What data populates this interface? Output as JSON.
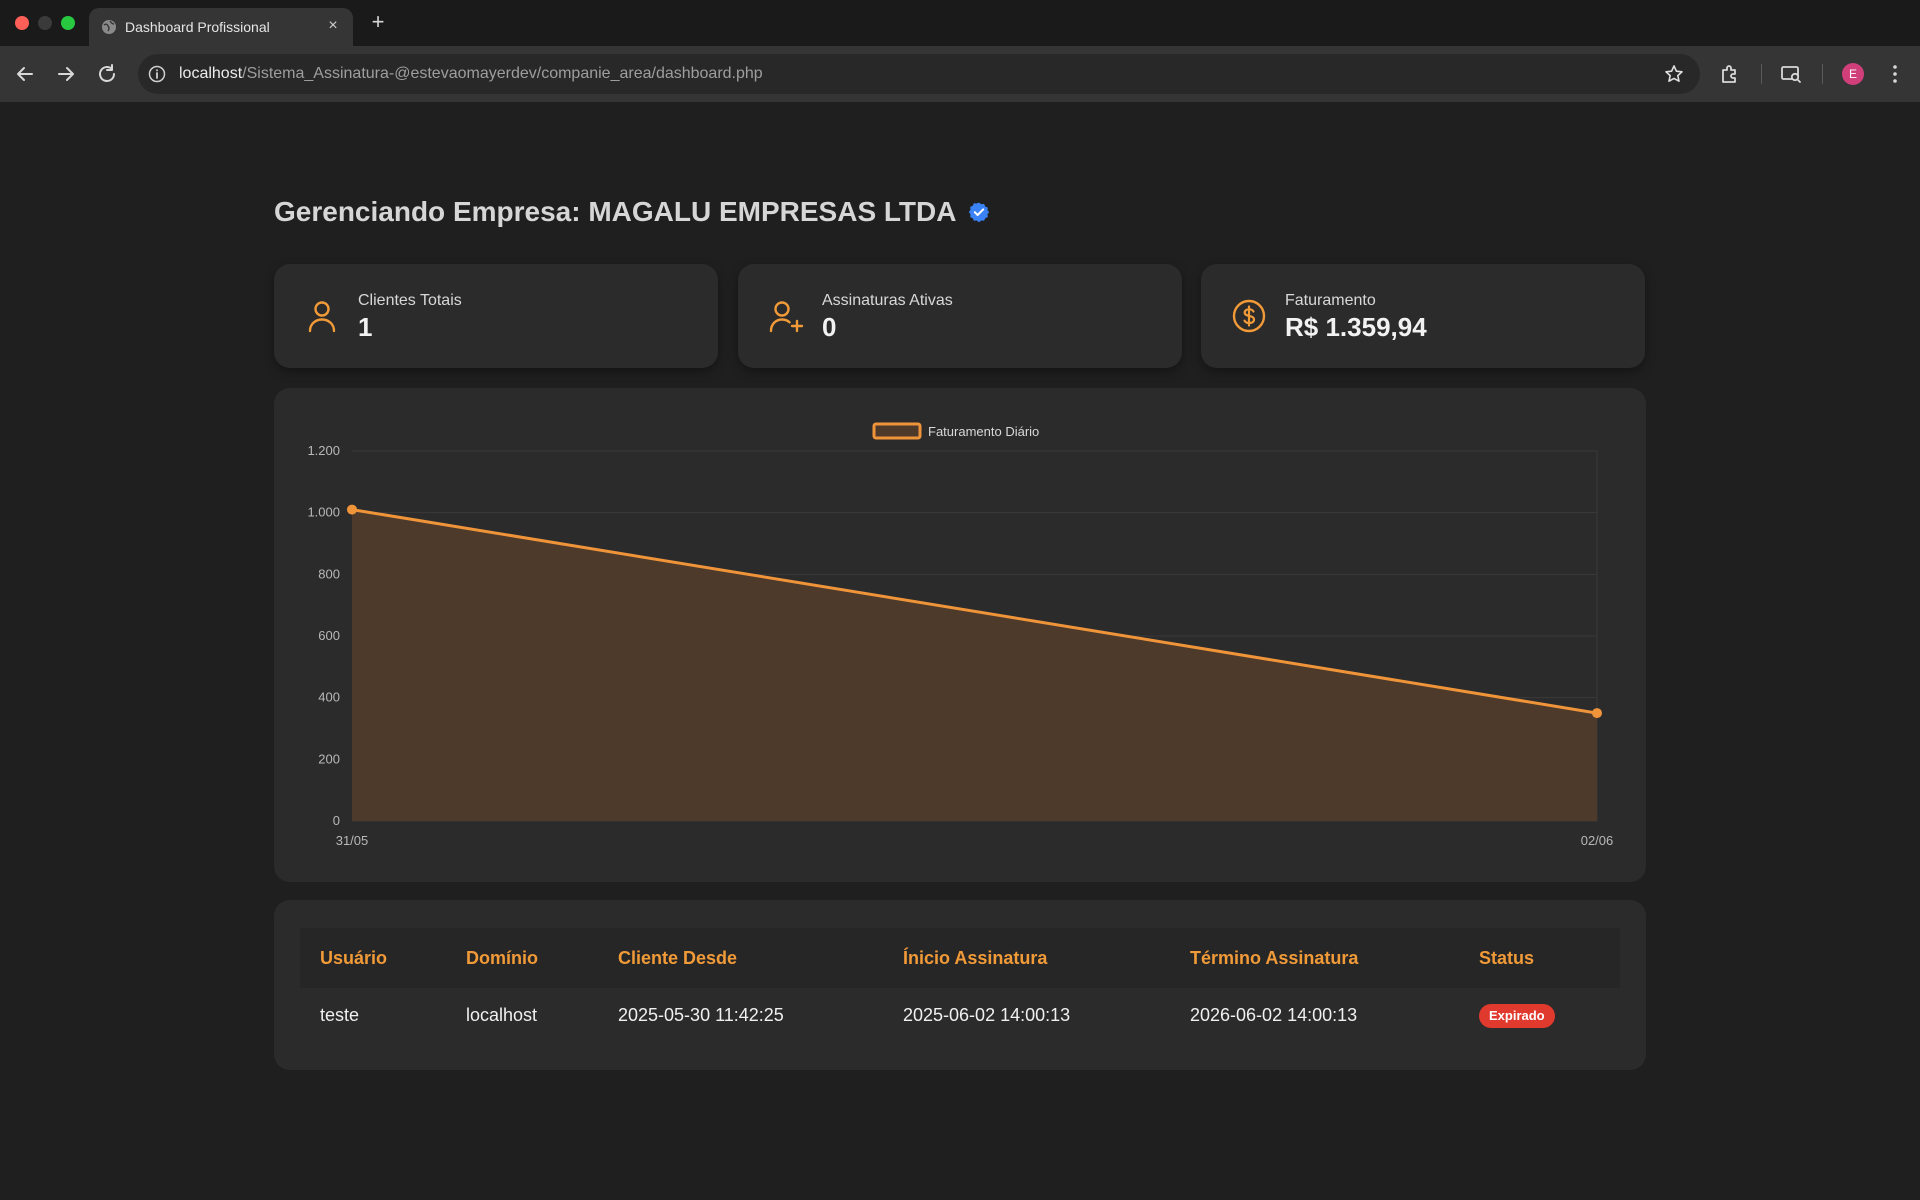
{
  "browser": {
    "tab_title": "Dashboard Profissional",
    "tab_close": "×",
    "new_tab": "+",
    "url_host": "localhost",
    "url_path": "/Sistema_Assinatura-@estevaomayerdev/companie_area/dashboard.php",
    "avatar_initial": "E"
  },
  "page": {
    "heading": "Gerenciando Empresa: MAGALU EMPRESAS LTDA"
  },
  "cards": [
    {
      "label": "Clientes Totais",
      "value": "1",
      "icon": "user-icon"
    },
    {
      "label": "Assinaturas Ativas",
      "value": "0",
      "icon": "user-plus-icon"
    },
    {
      "label": "Faturamento",
      "value": "R$ 1.359,94",
      "icon": "dollar-circle-icon"
    }
  ],
  "chart_data": {
    "type": "area",
    "x": [
      "31/05",
      "02/06"
    ],
    "series": [
      {
        "name": "Faturamento Diário",
        "values": [
          1010,
          350
        ]
      }
    ],
    "yticks": [
      "0",
      "200",
      "400",
      "600",
      "800",
      "1.000",
      "1.200"
    ],
    "ylim": [
      0,
      1200
    ],
    "legend": "top-center",
    "grid": true,
    "colors": {
      "line": "#f0943a",
      "fill": "#4d3a2b"
    }
  },
  "table": {
    "headers": [
      "Usuário",
      "Domínio",
      "Cliente Desde",
      "Ínicio Assinatura",
      "Término Assinatura",
      "Status"
    ],
    "rows": [
      [
        "teste",
        "localhost",
        "2025-05-30 11:42:25",
        "2025-06-02 14:00:13",
        "2026-06-02 14:00:13",
        "Expirado"
      ]
    ]
  },
  "colors": {
    "accent": "#f19a38",
    "badge_expired": "#e03a2e",
    "verified": "#3b82f6"
  }
}
